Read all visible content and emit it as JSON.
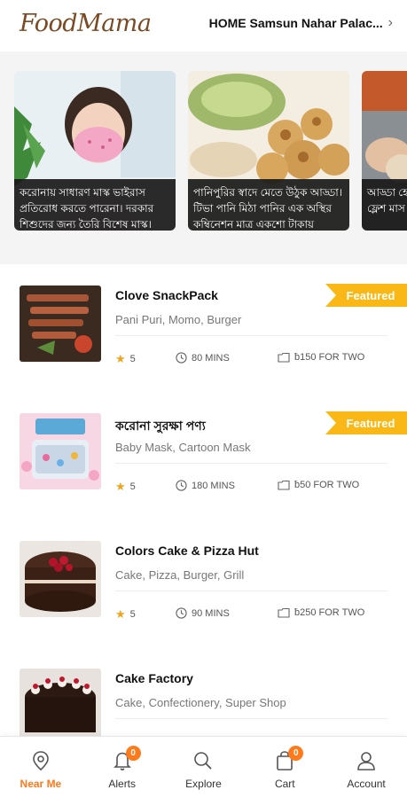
{
  "header": {
    "logo": "FoodMama",
    "location": "HOME Samsun Nahar Palac..."
  },
  "banners": [
    {
      "caption": "করোনায় সাধারণ মাস্ক ভাইরাস প্রতিরোধ করতে পারেনা। দরকার শিশুদের জন্য তৈরি বিশেষ মাস্ক।"
    },
    {
      "caption": "পানিপুরির স্বাদে মেতে উঠুক আড্ডা। টিভা পানি মিঠা পানির এক অস্থির কম্বিনেশন মাত্র একশো টাকায়"
    },
    {
      "caption": "আড্ডা হে নেপালি ডি ফ্লেশ মাস"
    }
  ],
  "restaurants": [
    {
      "name": "Clove SnackPack",
      "tags": "Pani Puri, Momo, Burger",
      "rating": "5",
      "time": "80 MINS",
      "price": "ƀ150 FOR TWO",
      "featured": "Featured"
    },
    {
      "name": "করোনা সুরক্ষা পণ্য",
      "tags": "Baby Mask, Cartoon Mask",
      "rating": "5",
      "time": "180 MINS",
      "price": "ƀ50 FOR TWO",
      "featured": "Featured"
    },
    {
      "name": "Colors Cake & Pizza Hut",
      "tags": "Cake, Pizza, Burger, Grill",
      "rating": "5",
      "time": "90 MINS",
      "price": "ƀ250 FOR TWO",
      "featured": ""
    },
    {
      "name": "Cake Factory",
      "tags": "Cake, Confectionery, Super Shop",
      "rating": "",
      "time": "",
      "price": "",
      "featured": ""
    }
  ],
  "nav": [
    {
      "label": "Near Me",
      "icon": "map-pin-icon",
      "badge": ""
    },
    {
      "label": "Alerts",
      "icon": "bell-icon",
      "badge": "0"
    },
    {
      "label": "Explore",
      "icon": "search-icon",
      "badge": ""
    },
    {
      "label": "Cart",
      "icon": "bag-icon",
      "badge": "0"
    },
    {
      "label": "Account",
      "icon": "user-icon",
      "badge": ""
    }
  ],
  "colors": {
    "accent": "#ff7a1a",
    "featured": "#f9b816",
    "star": "#f7a21b"
  }
}
